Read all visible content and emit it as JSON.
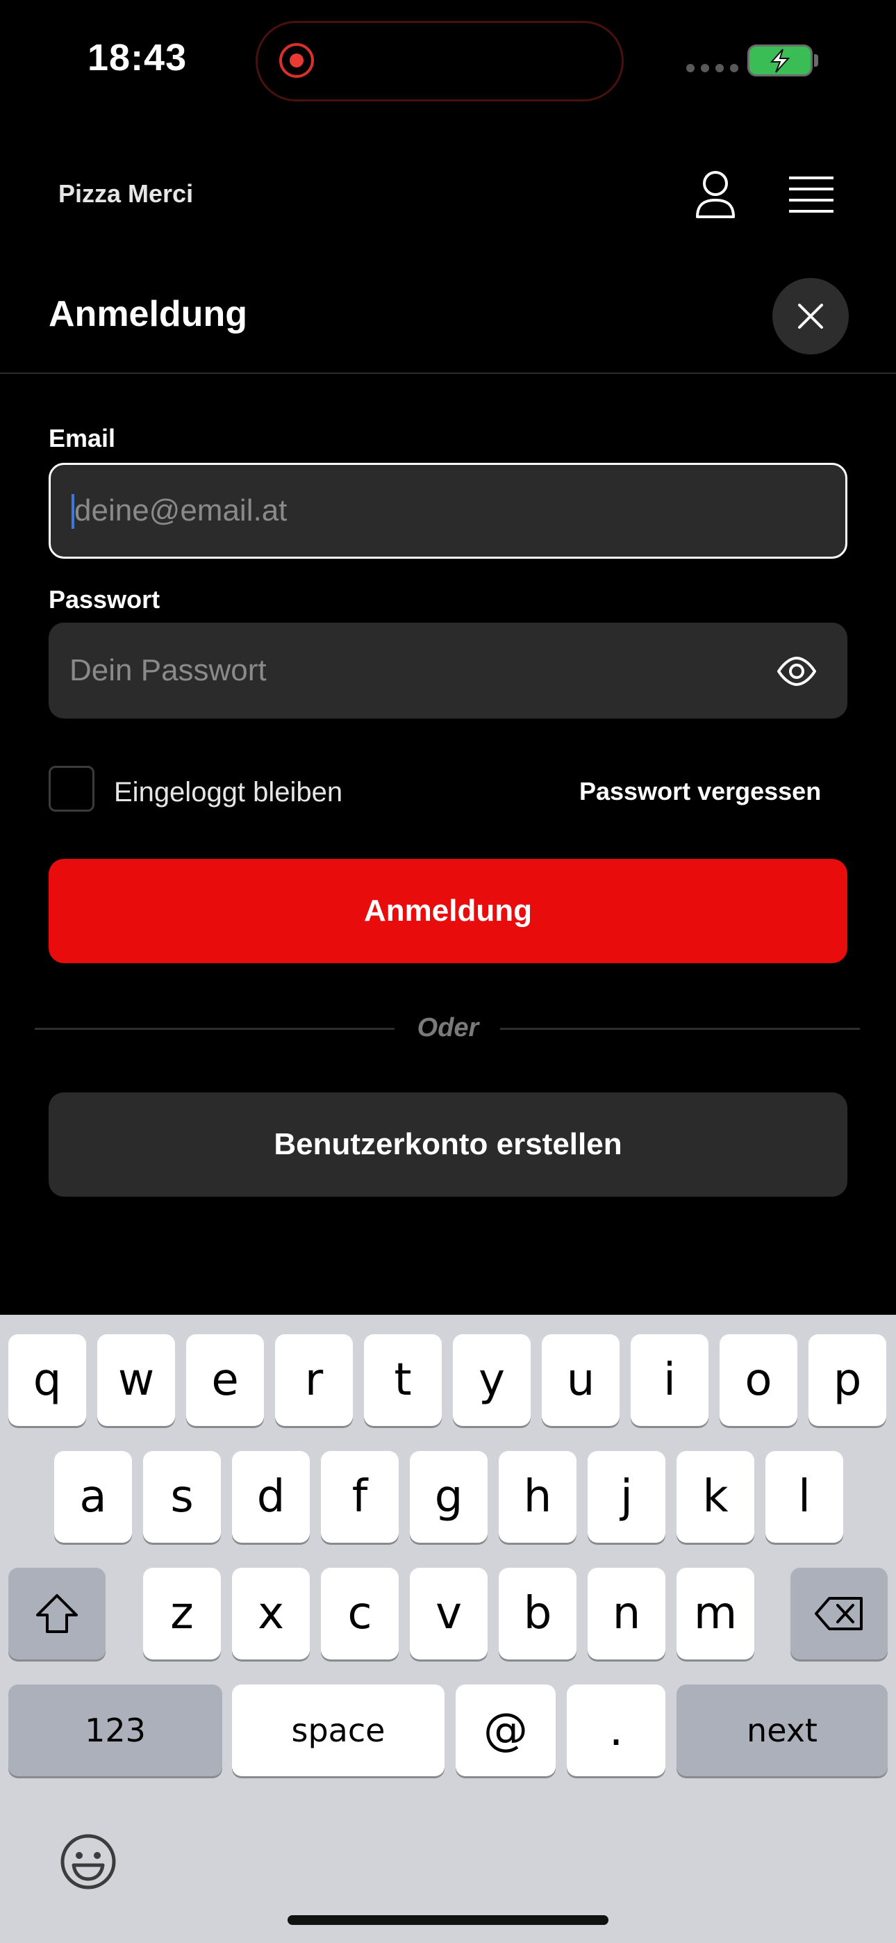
{
  "status_bar": {
    "time": "18:43"
  },
  "header": {
    "brand": "Pizza Merci"
  },
  "modal": {
    "title": "Anmeldung",
    "email_label": "Email",
    "email_placeholder": "deine@email.at",
    "password_label": "Passwort",
    "password_placeholder": "Dein Passwort",
    "remember_label": "Eingeloggt bleiben",
    "forgot_label": "Passwort vergessen",
    "login_button": "Anmeldung",
    "or_text": "Oder",
    "register_button": "Benutzerkonto erstellen"
  },
  "colors": {
    "primary": "#e90c0c",
    "field_bg": "#2b2b2b",
    "background": "#000000",
    "keyboard_bg": "#d1d3d9"
  },
  "keyboard": {
    "row1": [
      "q",
      "w",
      "e",
      "r",
      "t",
      "y",
      "u",
      "i",
      "o",
      "p"
    ],
    "row2": [
      "a",
      "s",
      "d",
      "f",
      "g",
      "h",
      "j",
      "k",
      "l"
    ],
    "row3": [
      "z",
      "x",
      "c",
      "v",
      "b",
      "n",
      "m"
    ],
    "numbers_key": "123",
    "space_key": "space",
    "at_key": "@",
    "dot_key": ".",
    "next_key": "next"
  }
}
